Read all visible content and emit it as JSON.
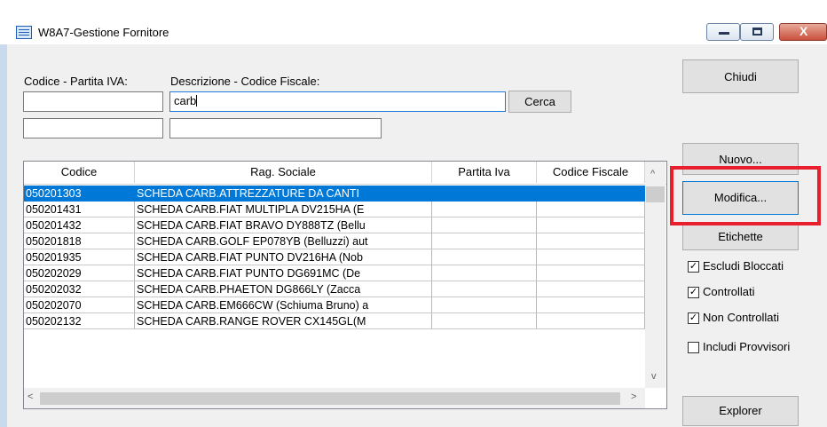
{
  "window": {
    "title": "W8A7-Gestione Fornitore",
    "close_glyph": "X"
  },
  "filters": {
    "codice_label": "Codice - Partita IVA:",
    "descrizione_label": "Descrizione - Codice Fiscale:",
    "codice_value": "",
    "partita_iva_value": "",
    "descrizione_value": "carb",
    "codice_fiscale_value": "",
    "search_button": "Cerca"
  },
  "buttons": {
    "chiudi": "Chiudi",
    "nuovo": "Nuovo...",
    "modifica": "Modifica...",
    "etichette": "Etichette",
    "explorer": "Explorer"
  },
  "options": [
    {
      "label": "Escludi Bloccati",
      "checked": true
    },
    {
      "label": "Controllati",
      "checked": true
    },
    {
      "label": "Non Controllati",
      "checked": true
    },
    {
      "label": "Includi Provvisori",
      "checked": false
    }
  ],
  "grid": {
    "columns": [
      "Codice",
      "Rag. Sociale",
      "Partita Iva",
      "Codice Fiscale"
    ],
    "rows": [
      {
        "codice": "050201303",
        "rag": "SCHEDA CARB.ATTREZZATURE DA CANTI",
        "piva": "",
        "cf": "",
        "selected": true
      },
      {
        "codice": "050201431",
        "rag": "SCHEDA CARB.FIAT MULTIPLA DV215HA (E",
        "piva": "",
        "cf": ""
      },
      {
        "codice": "050201432",
        "rag": "SCHEDA CARB.FIAT BRAVO DY888TZ (Bellu",
        "piva": "",
        "cf": ""
      },
      {
        "codice": "050201818",
        "rag": "SCHEDA CARB.GOLF EP078YB (Belluzzi) aut",
        "piva": "",
        "cf": ""
      },
      {
        "codice": "050201935",
        "rag": "SCHEDA CARB.FIAT PUNTO DV216HA (Nob",
        "piva": "",
        "cf": ""
      },
      {
        "codice": "050202029",
        "rag": "SCHEDA CARB.FIAT PUNTO DG691MC (De",
        "piva": "",
        "cf": ""
      },
      {
        "codice": "050202032",
        "rag": "SCHEDA CARB.PHAETON DG866LY (Zacca",
        "piva": "",
        "cf": ""
      },
      {
        "codice": "050202070",
        "rag": "SCHEDA CARB.EM666CW (Schiuma Bruno) a",
        "piva": "",
        "cf": ""
      },
      {
        "codice": "050202132",
        "rag": "SCHEDA CARB.RANGE ROVER CX145GL(M",
        "piva": "",
        "cf": ""
      }
    ]
  },
  "scroll_glyphs": {
    "up": "^",
    "down": "v",
    "left": "<",
    "right": ">"
  },
  "colors": {
    "selection": "#0078d7",
    "highlight_box": "#e8202e"
  }
}
